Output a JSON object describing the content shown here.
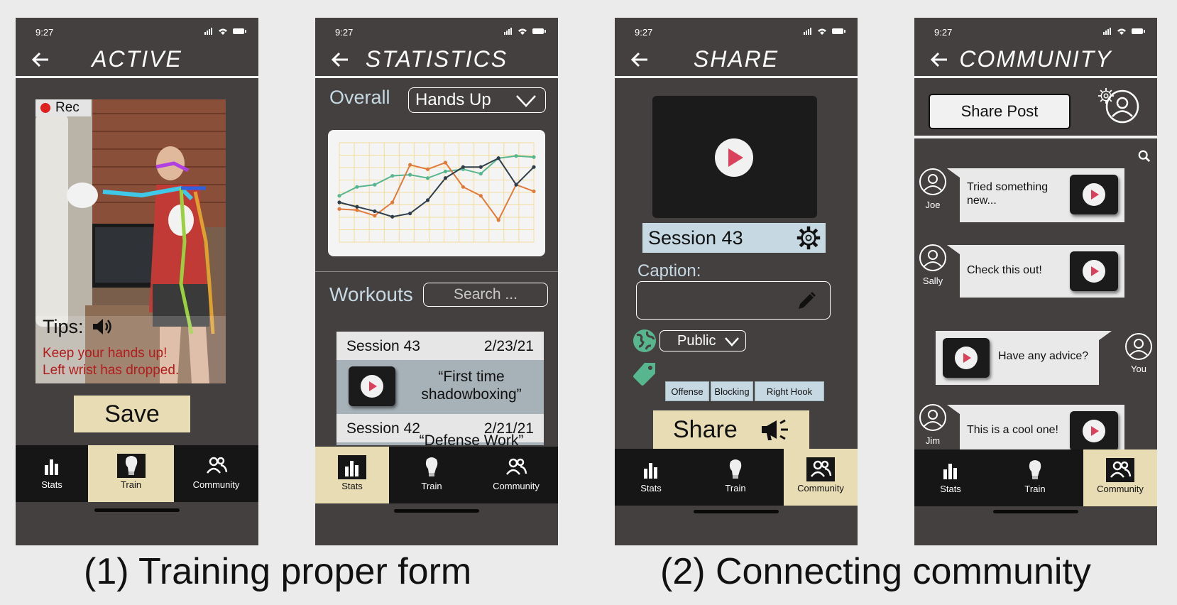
{
  "status": {
    "time": "9:27"
  },
  "screens": {
    "active": {
      "title": "ACTIVE",
      "rec_label": "Rec",
      "tips_label": "Tips:",
      "tip_line1": "Keep your hands up!",
      "tip_line2": "Left wrist has dropped.",
      "save_label": "Save"
    },
    "statistics": {
      "title": "STATISTICS",
      "overall_label": "Overall",
      "dropdown_value": "Hands Up",
      "workouts_label": "Workouts",
      "search_placeholder": "Search ...",
      "sessions": [
        {
          "name": "Session 43",
          "date": "2/23/21",
          "line1": "“First time",
          "line2": "shadowboxing”"
        },
        {
          "name": "Session 42",
          "date": "2/21/21",
          "line1": "“Defense Work”",
          "line2": ""
        }
      ]
    },
    "share": {
      "title": "SHARE",
      "session_name": "Session 43",
      "caption_label": "Caption:",
      "caption_value": "",
      "visibility": "Public",
      "tags": [
        "Offense",
        "Blocking",
        "Right Hook"
      ],
      "share_label": "Share"
    },
    "community": {
      "title": "COMMUNITY",
      "share_post_label": "Share Post",
      "posts": [
        {
          "user": "Joe",
          "text_line1": "Tried something",
          "text_line2": "new..."
        },
        {
          "user": "Sally",
          "text_line1": "Check this out!",
          "text_line2": ""
        },
        {
          "user": "You",
          "text_line1": "Have any advice?",
          "text_line2": ""
        },
        {
          "user": "Jim",
          "text_line1": "This is a cool one!",
          "text_line2": ""
        }
      ]
    }
  },
  "nav": {
    "stats": "Stats",
    "train": "Train",
    "community": "Community"
  },
  "captions": {
    "left": "(1) Training proper form",
    "right": "(2) Connecting community"
  },
  "chart_data": {
    "type": "line",
    "title": "",
    "x": [
      0,
      1,
      2,
      3,
      4,
      5,
      6,
      7,
      8,
      9,
      10,
      11
    ],
    "series": [
      {
        "color": "#58b68f",
        "values": [
          62,
          70,
          72,
          80,
          81,
          78,
          84,
          86,
          82,
          96,
          98,
          97
        ]
      },
      {
        "color": "#e07a3b",
        "values": [
          50,
          49,
          44,
          56,
          90,
          86,
          92,
          70,
          62,
          40,
          72,
          66
        ]
      },
      {
        "color": "#2f3e4a",
        "values": [
          56,
          52,
          48,
          43,
          46,
          58,
          78,
          88,
          88,
          96,
          72,
          88
        ]
      }
    ],
    "ylim": [
      20,
      110
    ],
    "grid": true,
    "colors": {
      "grid": "#f2dc9a",
      "background": "#f4f4f4"
    }
  },
  "colors": {
    "background": "#444040",
    "accent": "#e8dcb5",
    "rec": "#e02020",
    "tip_text": "#b21c1c",
    "label_blue": "#c6d8e2",
    "play": "#d9425a"
  }
}
